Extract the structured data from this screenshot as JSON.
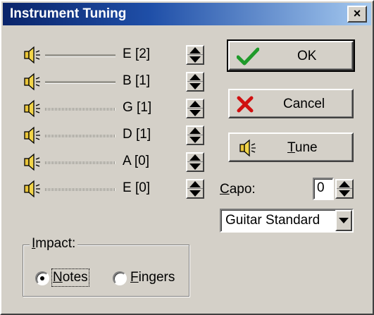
{
  "window": {
    "title": "Instrument Tuning",
    "close_label": "×"
  },
  "strings": [
    {
      "label": "E [2]",
      "type": "plain"
    },
    {
      "label": "B [1]",
      "type": "plain"
    },
    {
      "label": "G [1]",
      "type": "wound"
    },
    {
      "label": "D [1]",
      "type": "wound"
    },
    {
      "label": "A [0]",
      "type": "wound"
    },
    {
      "label": "E [0]",
      "type": "wound"
    }
  ],
  "buttons": {
    "ok_label": "OK",
    "cancel_label": "Cancel",
    "tune_label_underlined": "T",
    "tune_label_rest": "une"
  },
  "capo": {
    "label_underlined": "C",
    "label_rest": "apo:",
    "value": "0"
  },
  "preset": {
    "selected": "Guitar Standard"
  },
  "impact": {
    "legend_underlined": "I",
    "legend_rest": "mpact:",
    "options": [
      {
        "underlined": "N",
        "rest": "otes",
        "checked": true
      },
      {
        "underlined": "F",
        "rest": "ingers",
        "checked": false
      }
    ]
  },
  "colors": {
    "ok_check": "#1f9a2a",
    "cancel_x": "#d01010",
    "title_start": "#0a246a",
    "title_end": "#a6caf0"
  }
}
